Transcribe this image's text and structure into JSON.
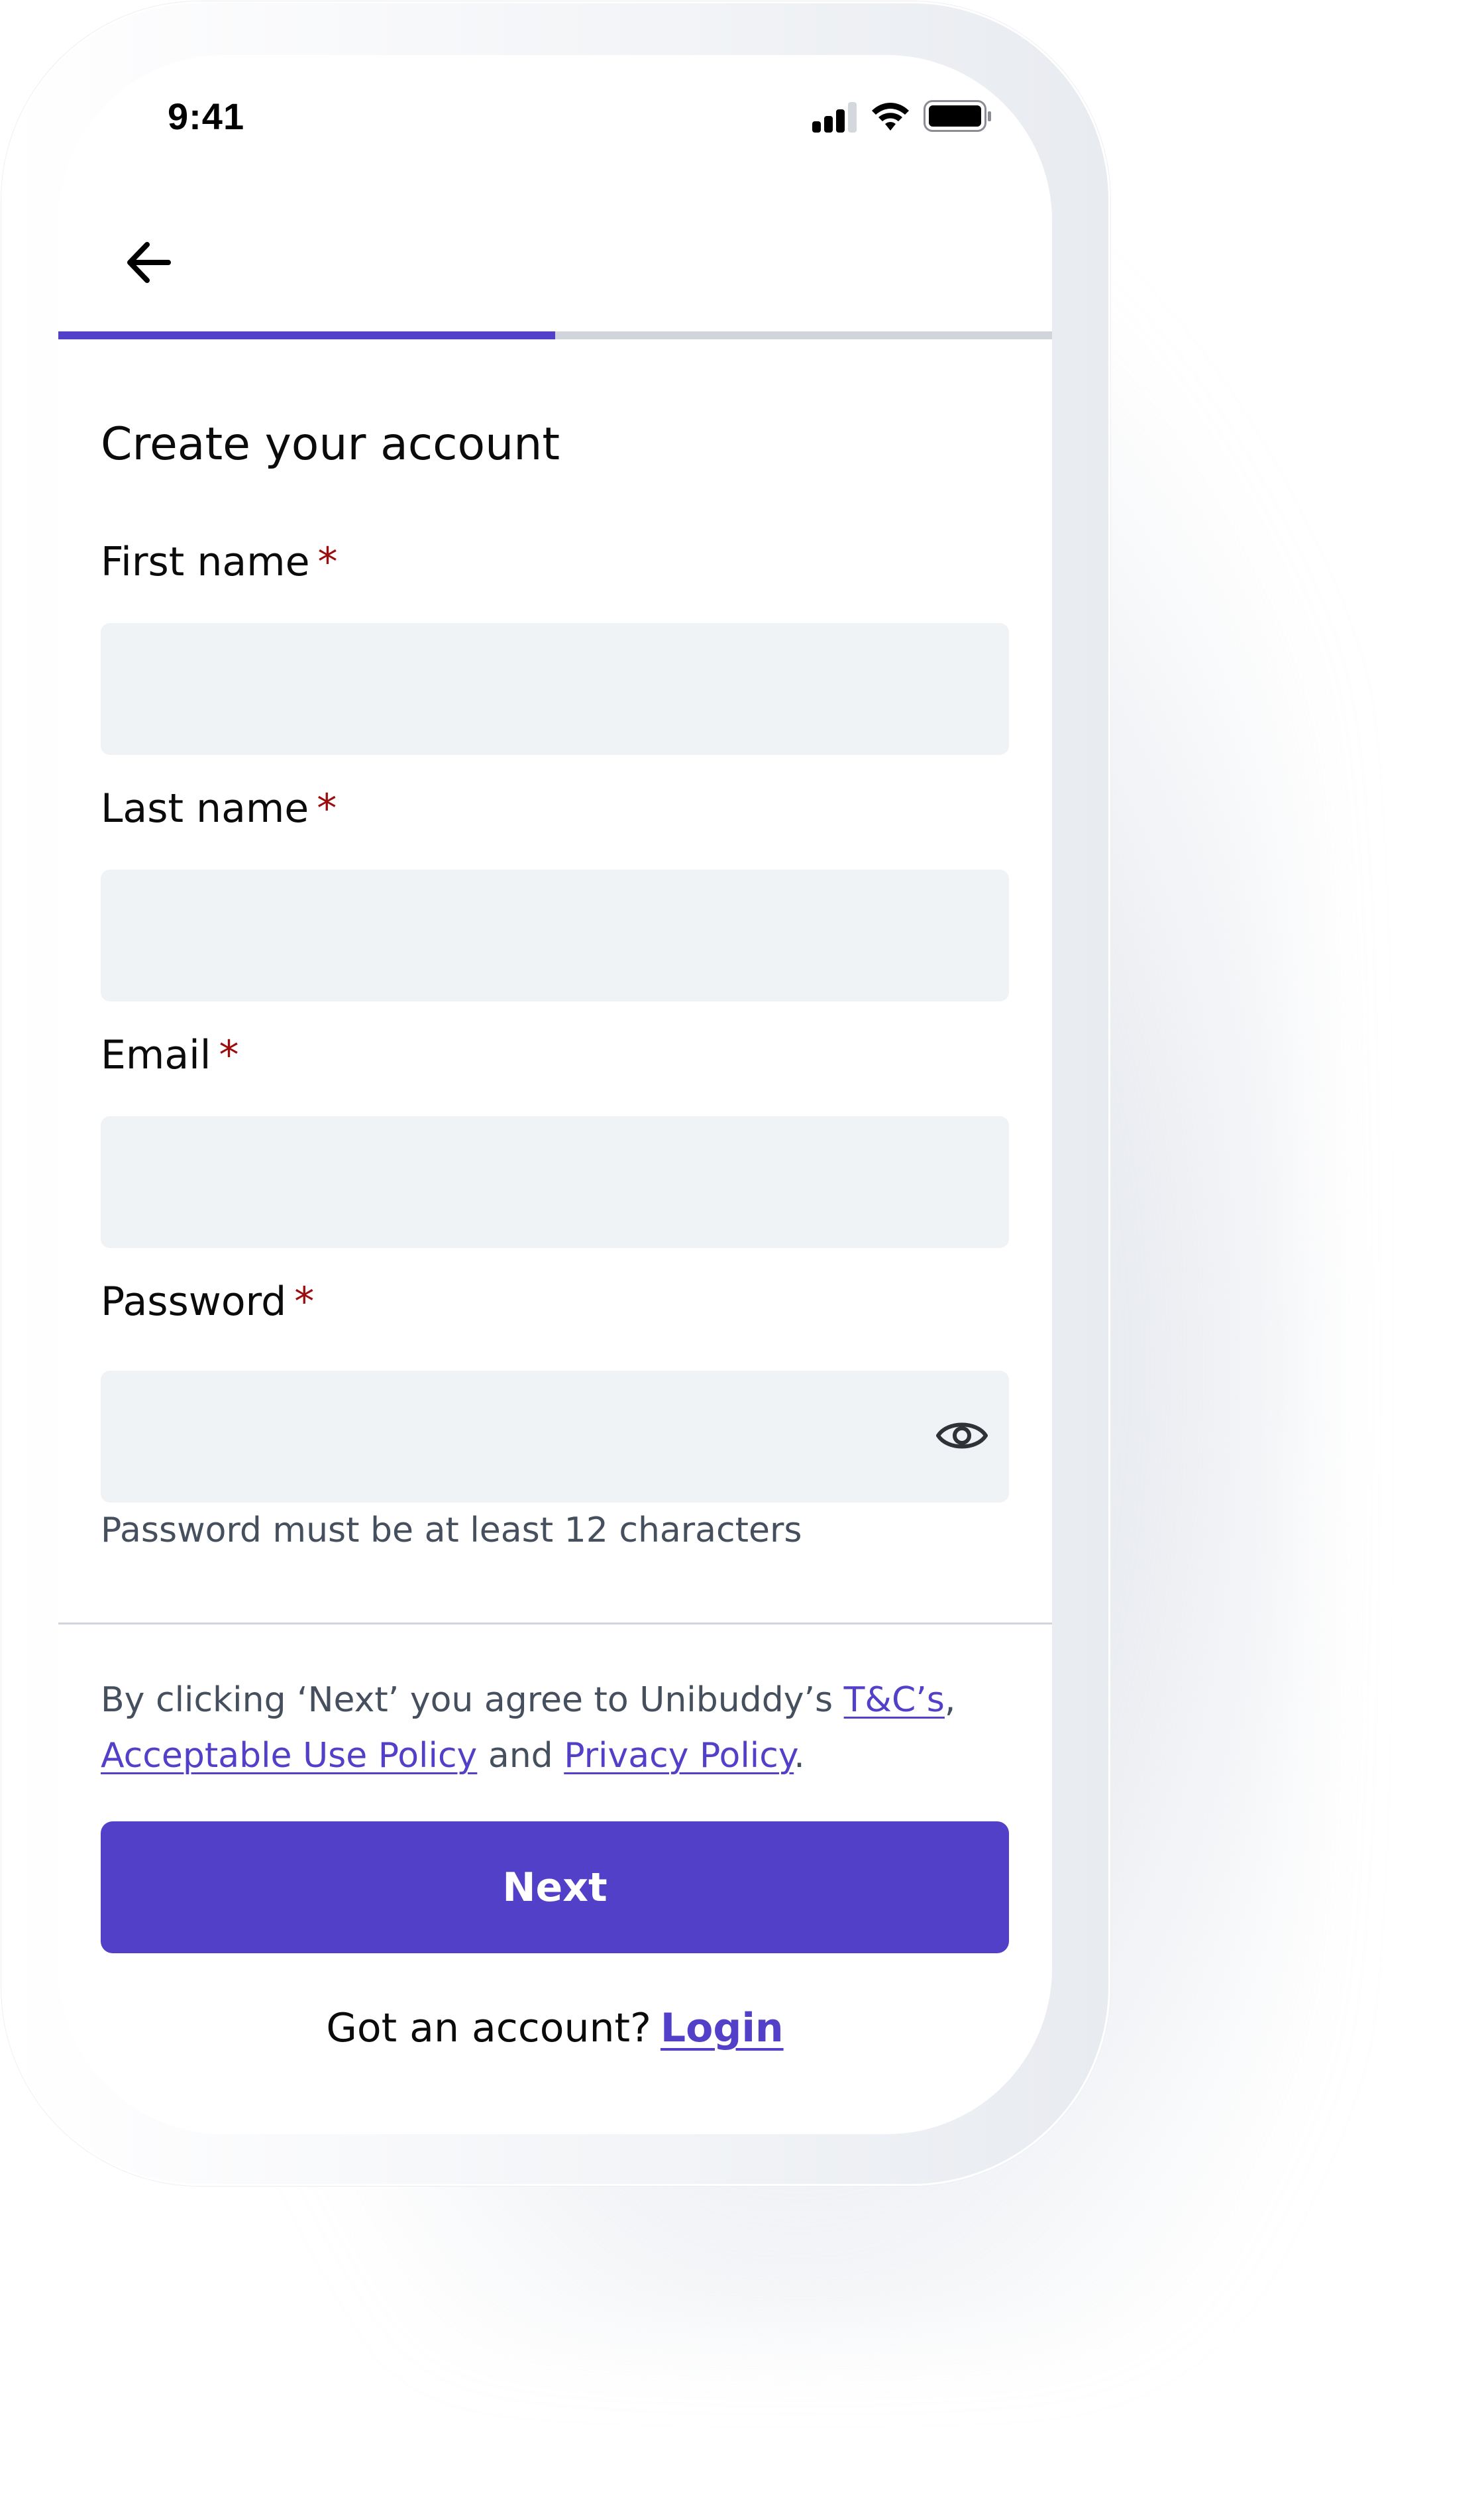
{
  "status_bar": {
    "time": "9:41",
    "signal_icon": "cellular-signal-icon",
    "signal_bars_filled": 3,
    "signal_bars_total": 4,
    "wifi_icon": "wifi-icon",
    "battery_icon": "battery-icon",
    "battery_level": 1.0
  },
  "header": {
    "back_icon": "arrow-left-icon",
    "progress_fraction": 0.5
  },
  "form": {
    "title": "Create your account",
    "required_marker": "*",
    "fields": [
      {
        "label": "First name",
        "value": "",
        "placeholder": "",
        "type": "text"
      },
      {
        "label": "Last name",
        "value": "",
        "placeholder": "",
        "type": "text"
      },
      {
        "label": "Email",
        "value": "",
        "placeholder": "",
        "type": "email"
      },
      {
        "label": "Password",
        "value": "",
        "placeholder": "",
        "type": "password",
        "toggle_icon": "eye-icon"
      }
    ],
    "password_helper": "Password must be at least 12 characters"
  },
  "terms": {
    "prefix": "By clicking ‘Next’ you agree to Unibuddy’s ",
    "tc_link": "T&C’s",
    "comma": ",",
    "aup_link": "Acceptable Use Policy",
    "and": " and ",
    "privacy_link": "Privacy Policy",
    "period": "."
  },
  "actions": {
    "next_label": "Next",
    "login_prompt": "Got an account?",
    "login_link": "Login"
  },
  "colors": {
    "accent": "#5240c8",
    "required": "#9b0d0d",
    "input_bg": "#f0f3f6",
    "muted_text": "#454f5e",
    "progress_track": "#d1d5db"
  }
}
